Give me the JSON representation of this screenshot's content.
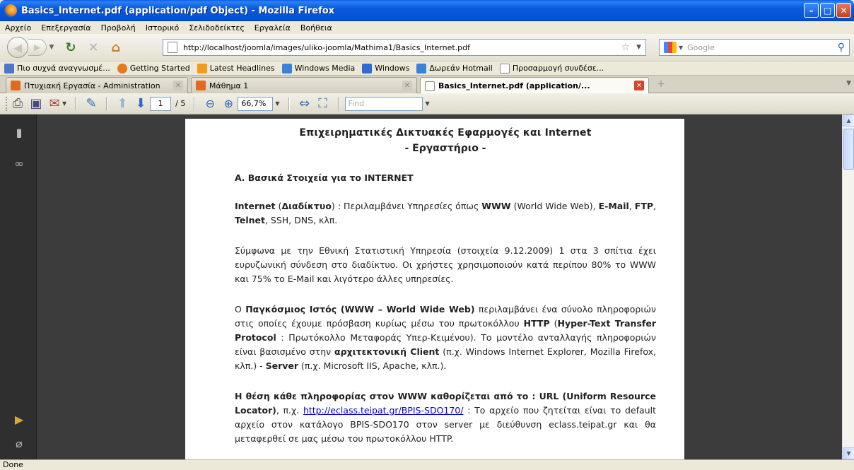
{
  "window": {
    "title": "Basics_Internet.pdf (application/pdf Object) - Mozilla Firefox",
    "buttons": {
      "minimize": "–",
      "maximize": "□",
      "close": "✕"
    }
  },
  "menu": [
    "Αρχείο",
    "Επεξεργασία",
    "Προβολή",
    "Ιστορικό",
    "Σελιδοδείκτες",
    "Εργαλεία",
    "Βοήθεια"
  ],
  "nav": {
    "url": "http://localhost/joomla/images/uliko-joomla/Mathima1/Basics_Internet.pdf",
    "search_placeholder": "Google"
  },
  "bookmarks": [
    {
      "label": "Πιο συχνά αναγνωσμέ...",
      "icon": "most-visited-icon",
      "color": "#4a78c9"
    },
    {
      "label": "Getting Started",
      "icon": "firefox-icon",
      "color": "#e37a1b"
    },
    {
      "label": "Latest Headlines",
      "icon": "rss-icon",
      "color": "#f29b1c"
    },
    {
      "label": "Windows Media",
      "icon": "windows-icon",
      "color": "#3c82d8"
    },
    {
      "label": "Windows",
      "icon": "msn-icon",
      "color": "#2f6bd1"
    },
    {
      "label": "Δωρεάν Hotmail",
      "icon": "windows-icon",
      "color": "#3c82d8"
    },
    {
      "label": "Προσαρμογή συνδέσε...",
      "icon": "page-icon",
      "color": "#ffffff"
    }
  ],
  "tabs": [
    {
      "label": "Πτυχιακή Εργασία - Administration",
      "icon": "joomla-icon",
      "active": false
    },
    {
      "label": "Μάθημα 1",
      "icon": "joomla-icon",
      "active": false
    },
    {
      "label": "Basics_Internet.pdf (application/...",
      "icon": "page-icon",
      "active": true
    }
  ],
  "pdf_toolbar": {
    "page_current": "1",
    "page_total": "/ 5",
    "zoom": "66,7%",
    "find_placeholder": "Find"
  },
  "document": {
    "title": "Επιχειρηματικές Δικτυακές Εφαρμογές και Internet",
    "subtitle": "- Εργαστήριο -",
    "section": "Α. Βασικά Στοιχεία για το INTERNET",
    "p1": {
      "b1": "Internet",
      "t1": " (",
      "b2": "Διαδίκτυο",
      "t2": ") : Περιλαμβάνει Υπηρεσίες όπως ",
      "b3": "WWW",
      "t3": " (World Wide Web), ",
      "b4": "E-Mail",
      "t4": ", ",
      "b5": "FTP",
      "t5": ", ",
      "b6": "Telnet",
      "t6": ", SSH, DNS, κλπ."
    },
    "p2": "Σύμφωνα με την Εθνική Στατιστική Υπηρεσία (στοιχεία 9.12.2009) 1 στα 3 σπίτια έχει ευρυζωνική σύνδεση στο διαδίκτυο. Οι χρήστες χρησιμοποιούν κατά περίπου 80% το WWW και 75% το E-Mail και λιγότερο άλλες υπηρεσίες.",
    "p3": {
      "t1": "Ο ",
      "b1": "Παγκόσμιος Ιστός (WWW – World Wide Web)",
      "t2": " περιλαμβάνει ένα σύνολο πληροφοριών στις οποίες έχουμε πρόσβαση κυρίως μέσω του πρωτοκόλλου ",
      "b2": "HTTP",
      "t3": " (",
      "b3": "Hyper-Text Transfer Protocol",
      "t4": " : Πρωτόκολλο Μεταφοράς Υπερ-Κειμένου). Το μοντέλο ανταλλαγής πληροφοριών είναι βασισμένο στην ",
      "b4": "αρχιτεκτονική Client",
      "t5": " (π.χ. Windows Internet Explorer, Mozilla Firefox, κλπ.) - ",
      "b5": "Server",
      "t6": " (π.χ. Microsoft IIS, Apache, κλπ.)."
    },
    "p4": {
      "b1": "Η θέση κάθε πληροφορίας στον WWW καθορίζεται από το : URL (Uniform Resource Locator)",
      "t1": ", π.χ. ",
      "link": "http://eclass.teipat.gr/BPIS-SDO170/",
      "t2": " : Το αρχείο που ζητείται είναι το default αρχείο στον κατάλογο BPIS-SDO170 στον server με διεύθυνση eclass.teipat.gr και θα μεταφερθεί σε μας μέσω του πρωτοκόλλου HTTP."
    }
  },
  "status": "Done",
  "colors": {
    "titlebar": "#0a5de4",
    "viewer_bg": "#3c3c3c",
    "sidebar_bg": "#2f2f2f",
    "link": "#0000cc"
  }
}
